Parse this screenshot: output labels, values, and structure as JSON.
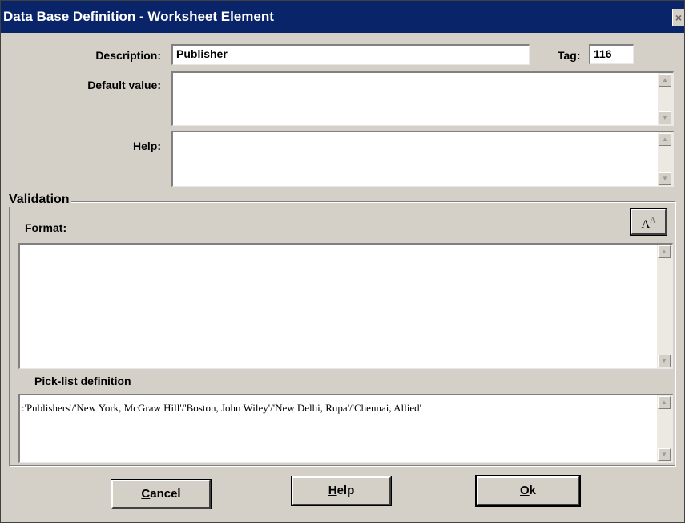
{
  "window": {
    "title": "Data Base Definition - Worksheet Element"
  },
  "fields": {
    "description_label": "Description:",
    "description_value": "Publisher",
    "tag_label": "Tag:",
    "tag_value": "116",
    "default_label": "Default value:",
    "default_value": "",
    "help_label": "Help:",
    "help_value": ""
  },
  "validation": {
    "group_label": "Validation",
    "format_label": "Format:",
    "format_value": "",
    "font_button": "A",
    "font_button_sup": "A",
    "picklist_label": "Pick-list definition",
    "picklist_value": ":'Publishers'/'New York, McGraw Hill'/'Boston, John Wiley'/'New Delhi, Rupa'/'Chennai, Allied'"
  },
  "buttons": {
    "cancel": {
      "mnemonic": "C",
      "rest": "ancel"
    },
    "help": {
      "mnemonic": "H",
      "rest": "elp"
    },
    "ok": {
      "mnemonic": "O",
      "rest": "k"
    }
  },
  "icons": {
    "close": "close-icon",
    "scroll_up": "arrow-up-icon",
    "scroll_down": "arrow-down-icon",
    "font": "font-icon"
  },
  "colors": {
    "titlebar": "#0a246a",
    "window_face": "#d4d0c8",
    "field_bg": "#ffffff"
  }
}
